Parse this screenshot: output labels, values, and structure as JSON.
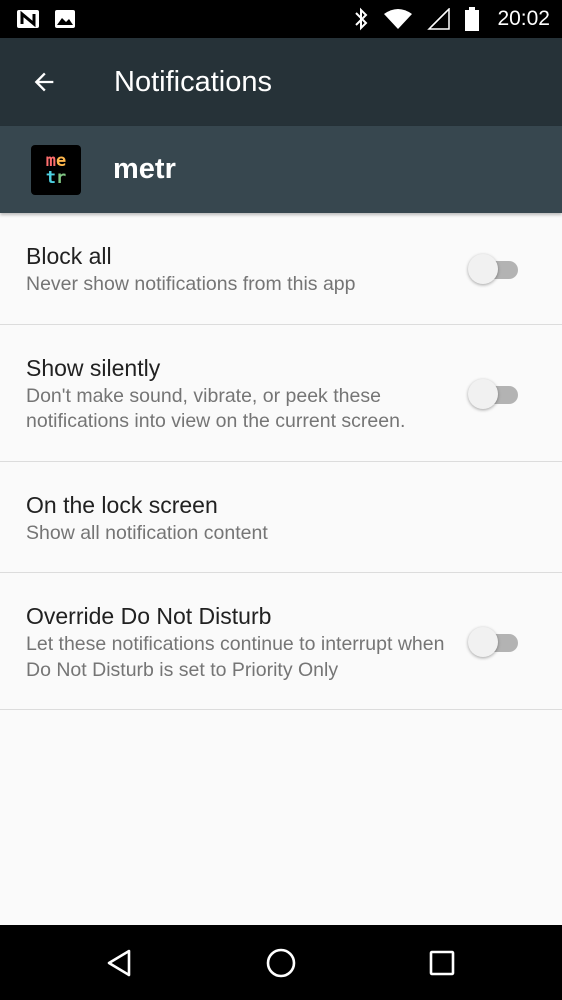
{
  "status_bar": {
    "time": "20:02",
    "icons": [
      "n-notification-icon",
      "image-notification-icon",
      "bluetooth-icon",
      "wifi-icon",
      "cellular-signal-icon",
      "battery-icon"
    ]
  },
  "toolbar": {
    "title": "Notifications",
    "back_icon": "arrow-back-icon"
  },
  "app": {
    "name": "metr",
    "icon_text_top": [
      "m",
      "e"
    ],
    "icon_text_bottom": [
      "t",
      "r"
    ],
    "icon_colors": {
      "m": "#ff6e6e",
      "e": "#ffb74d",
      "t": "#4dd0e1",
      "r": "#81c784"
    }
  },
  "settings": [
    {
      "title": "Block all",
      "summary": "Never show notifications from this app",
      "has_switch": true,
      "checked": false
    },
    {
      "title": "Show silently",
      "summary": "Don't make sound, vibrate, or peek these notifications into view on the current screen.",
      "has_switch": true,
      "checked": false
    },
    {
      "title": "On the lock screen",
      "summary": "Show all notification content",
      "has_switch": false
    },
    {
      "title": "Override Do Not Disturb",
      "summary": "Let these notifications continue to interrupt when Do Not Disturb is set to Priority Only",
      "has_switch": true,
      "checked": false
    }
  ],
  "colors": {
    "toolbar": "#263238",
    "app_header": "#37474f",
    "background": "#fafafa"
  },
  "nav_bar": {
    "icons": [
      "back-triangle-icon",
      "home-circle-icon",
      "recents-square-icon"
    ]
  }
}
